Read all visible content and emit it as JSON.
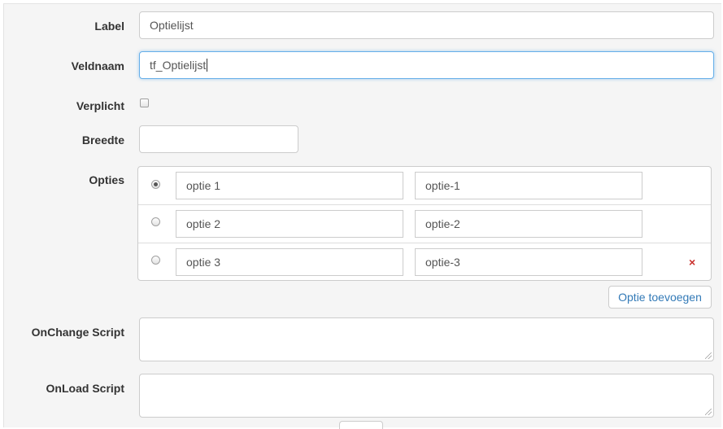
{
  "form": {
    "label": {
      "label": "Label",
      "value": "Optielijst"
    },
    "veldnaam": {
      "label": "Veldnaam",
      "value": "tf_Optielijst"
    },
    "verplicht": {
      "label": "Verplicht",
      "checked": false
    },
    "breedte": {
      "label": "Breedte",
      "value": ""
    },
    "opties": {
      "label": "Opties",
      "items": [
        {
          "text": "optie 1",
          "value": "optie-1",
          "selected": true
        },
        {
          "text": "optie 2",
          "value": "optie-2",
          "selected": false
        },
        {
          "text": "optie 3",
          "value": "optie-3",
          "selected": false,
          "remove_icon": "×"
        }
      ],
      "add_label": "Optie toevoegen"
    },
    "onchange": {
      "label": "OnChange Script",
      "value": ""
    },
    "onload": {
      "label": "OnLoad Script",
      "value": ""
    }
  },
  "colors": {
    "link": "#337ab7",
    "remove": "#c9302c",
    "focus": "#66afe9"
  }
}
